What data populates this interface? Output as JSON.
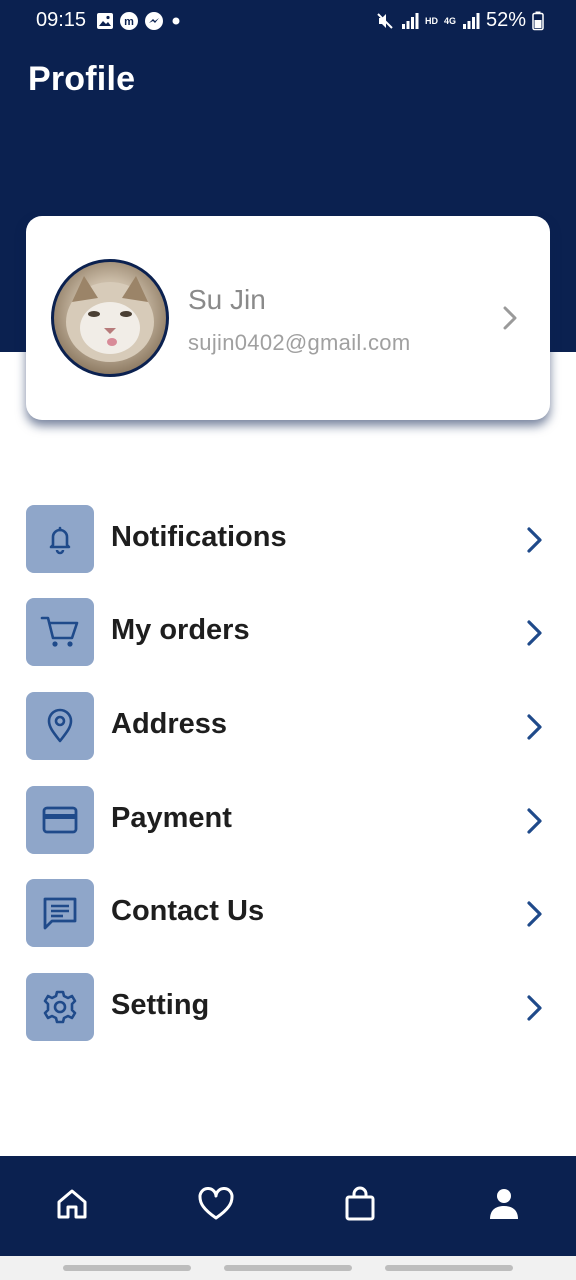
{
  "status_bar": {
    "time": "09:15",
    "network_label": "HD",
    "network_type": "4G",
    "battery": "52%"
  },
  "header": {
    "title": "Profile"
  },
  "profile": {
    "name": "Su Jin",
    "email": "sujin0402@gmail.com",
    "avatar_icon": "cat-photo-avatar"
  },
  "menu": {
    "items": [
      {
        "label": "Notifications",
        "icon": "bell-icon"
      },
      {
        "label": "My orders",
        "icon": "cart-icon"
      },
      {
        "label": "Address",
        "icon": "location-pin-icon"
      },
      {
        "label": "Payment",
        "icon": "credit-card-icon"
      },
      {
        "label": "Contact Us",
        "icon": "chat-icon"
      },
      {
        "label": "Setting",
        "icon": "gear-icon"
      }
    ]
  },
  "bottom_nav": {
    "items": [
      {
        "icon": "home-icon"
      },
      {
        "icon": "heart-icon"
      },
      {
        "icon": "shopping-bag-icon"
      },
      {
        "icon": "user-icon",
        "active": true
      }
    ]
  },
  "colors": {
    "navy": "#0b2150",
    "icon_tile": "#8fa6c9",
    "accent": "#1f4a8a"
  }
}
